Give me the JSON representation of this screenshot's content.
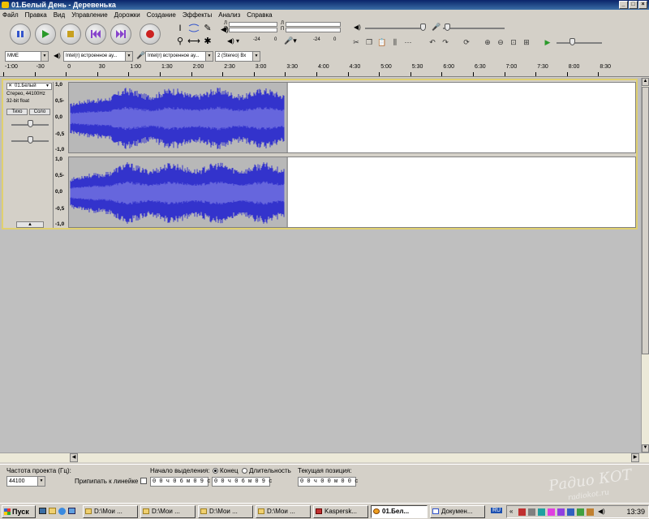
{
  "window": {
    "title": "01.Белый День - Деревенька",
    "controls": [
      "_",
      "□",
      "×"
    ]
  },
  "menu": [
    "Файл",
    "Правка",
    "Вид",
    "Управление",
    "Дорожки",
    "Создание",
    "Эффекты",
    "Анализ",
    "Справка"
  ],
  "transport": {
    "pause": "pause-icon",
    "play": "play-icon",
    "stop": "stop-icon",
    "skip_start": "skip-start-icon",
    "skip_end": "skip-end-icon",
    "record": "record-icon"
  },
  "tools": [
    "I",
    "✎",
    "⟷",
    "✱",
    "⚲",
    "↔"
  ],
  "meters": {
    "playback_labels": [
      "Л",
      "П"
    ],
    "record_labels": [
      "Л",
      "П"
    ],
    "scale": [
      "-24",
      "0"
    ]
  },
  "device_bar": {
    "host": "MME",
    "output_device": "Intel(r) встроенное ау...",
    "input_device": "Intel(r) встроенное ау...",
    "channels": "2 (Stereo) Вх"
  },
  "ruler": [
    "-1:00",
    "-30",
    "0",
    "30",
    "1:00",
    "1:30",
    "2:00",
    "2:30",
    "3:00",
    "3:30",
    "4:00",
    "4:30",
    "5:00",
    "5:30",
    "6:00",
    "6:30",
    "7:00",
    "7:30",
    "8:00",
    "8:30"
  ],
  "track": {
    "name": "01.Белый",
    "info1": "Стерео, 44100Hz",
    "info2": "32-bit float",
    "mute": "Тихо",
    "solo": "Соло",
    "scale": [
      "1,0",
      "0,5-",
      "0,0",
      "-0,5",
      "-1,0"
    ]
  },
  "selection_bar": {
    "rate_label": "Частота проекта (Гц):",
    "rate": "44100",
    "snap_label": "Припипать к линейке",
    "sel_start_label": "Начало выделения:",
    "end_option": "Конец",
    "length_option": "Длительность",
    "sel_start": "0 0 ч 0 6 м 0 9 с",
    "sel_end": "0 0 ч 0 6 м 0 9 с",
    "pos_label": "Текущая позиция:",
    "pos": "0 0 ч 0 0 м 0 0 с"
  },
  "taskbar": {
    "start": "Пуск",
    "tasks": [
      "D:\\Мои ...",
      "D:\\Мои ...",
      "D:\\Мои ...",
      "D:\\Мои ...",
      "Kaspersk...",
      "01.Бел...",
      "Докумен..."
    ],
    "lang": "RU",
    "clock": "13:39"
  },
  "watermark": {
    "line1": "Радио КОТ",
    "line2": "radiokot.ru"
  },
  "colors": {
    "waveform": "#3333cc",
    "waveform_rms": "#6666dd",
    "track_border": "#e0d070",
    "title_bar": "#0a246a"
  }
}
